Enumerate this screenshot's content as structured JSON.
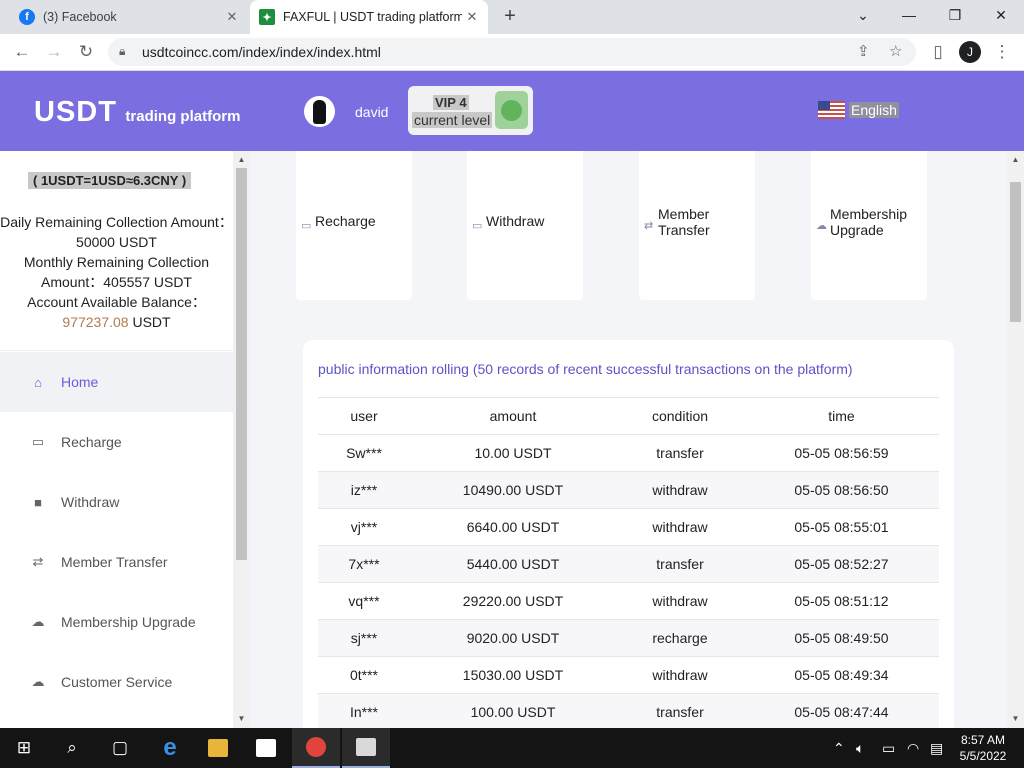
{
  "browser": {
    "tabs": [
      {
        "title": "(3) Facebook",
        "icon": "facebook-icon"
      },
      {
        "title": "FAXFUL | USDT trading platform",
        "icon": "site-favicon"
      }
    ],
    "url": "usdtcoincc.com/index/index/index.html",
    "profile_initial": "J"
  },
  "header": {
    "logo_main": "USDT",
    "logo_sub": "trading platform",
    "username": "david",
    "vip_level": "VIP 4",
    "vip_caption": "current level",
    "language": "English"
  },
  "sidebar": {
    "rate": "( 1USDT=1USD≈6.3CNY )",
    "daily_label": "Daily Remaining Collection Amount：",
    "daily_value": "50000 USDT",
    "monthly_label": "Monthly Remaining Collection Amount：",
    "monthly_value": "405557 USDT",
    "balance_label": "Account Available Balance：",
    "balance_value": "977237.08",
    "balance_unit": "USDT",
    "menu": [
      {
        "label": "Home",
        "icon": "home-icon",
        "active": true
      },
      {
        "label": "Recharge",
        "icon": "recharge-icon"
      },
      {
        "label": "Withdraw",
        "icon": "wallet-icon"
      },
      {
        "label": "Member Transfer",
        "icon": "transfer-icon"
      },
      {
        "label": "Membership Upgrade",
        "icon": "cloud-upgrade-icon"
      },
      {
        "label": "Customer Service",
        "icon": "cloud-service-icon"
      }
    ]
  },
  "quick_actions": [
    {
      "label": "Recharge",
      "icon": "recharge-icon"
    },
    {
      "label": "Withdraw",
      "icon": "withdraw-icon"
    },
    {
      "label": "Member Transfer",
      "icon": "transfer-icon"
    },
    {
      "label": "Membership Upgrade",
      "icon": "upgrade-icon"
    }
  ],
  "transactions": {
    "title": "public information rolling (50 records of recent successful transactions on the platform)",
    "headers": [
      "user",
      "amount",
      "condition",
      "time"
    ],
    "rows": [
      [
        "Sw***",
        "10.00 USDT",
        "transfer",
        "05-05 08:56:59"
      ],
      [
        "iz***",
        "10490.00 USDT",
        "withdraw",
        "05-05 08:56:50"
      ],
      [
        "vj***",
        "6640.00 USDT",
        "withdraw",
        "05-05 08:55:01"
      ],
      [
        "7x***",
        "5440.00 USDT",
        "transfer",
        "05-05 08:52:27"
      ],
      [
        "vq***",
        "29220.00 USDT",
        "withdraw",
        "05-05 08:51:12"
      ],
      [
        "sj***",
        "9020.00 USDT",
        "recharge",
        "05-05 08:49:50"
      ],
      [
        "0t***",
        "15030.00 USDT",
        "withdraw",
        "05-05 08:49:34"
      ],
      [
        "In***",
        "100.00 USDT",
        "transfer",
        "05-05 08:47:44"
      ]
    ]
  },
  "taskbar": {
    "time": "8:57 AM",
    "date": "5/5/2022"
  },
  "colors": {
    "header_bg": "#7b6ee0",
    "accent": "#6a5be0",
    "balance": "#b07a4d"
  }
}
